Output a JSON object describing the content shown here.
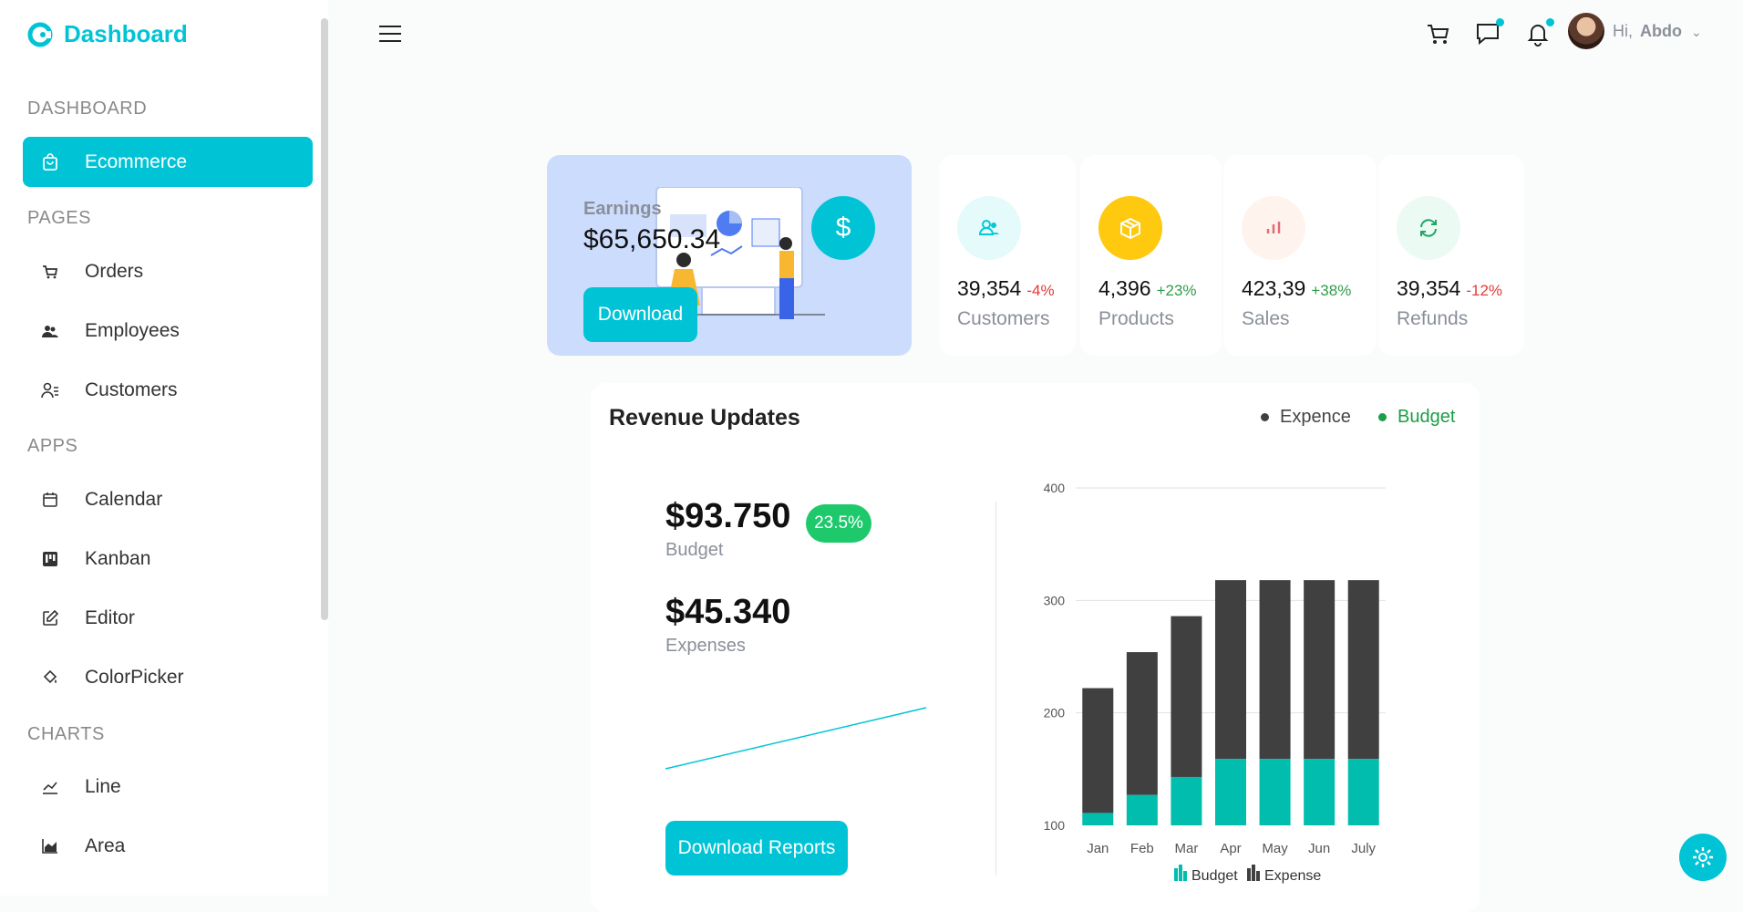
{
  "brand": {
    "name": "Dashboard"
  },
  "sidebar": {
    "sections": {
      "dashboard": "DASHBOARD",
      "pages": "PAGES",
      "apps": "APPS",
      "charts": "CHARTS"
    },
    "items": [
      {
        "label": "Ecommerce",
        "icon": "shopping-bag-icon"
      },
      {
        "label": "Orders",
        "icon": "cart-icon"
      },
      {
        "label": "Employees",
        "icon": "employees-icon"
      },
      {
        "label": "Customers",
        "icon": "customers-icon"
      },
      {
        "label": "Calendar",
        "icon": "calendar-icon"
      },
      {
        "label": "Kanban",
        "icon": "kanban-icon"
      },
      {
        "label": "Editor",
        "icon": "editor-icon"
      },
      {
        "label": "ColorPicker",
        "icon": "paint-bucket-icon"
      },
      {
        "label": "Line",
        "icon": "line-chart-icon"
      },
      {
        "label": "Area",
        "icon": "area-chart-icon"
      }
    ]
  },
  "header": {
    "greeting": "Hi,",
    "user": "Abdo"
  },
  "earnings": {
    "label": "Earnings",
    "value": "$65,650.34",
    "button": "Download",
    "currency_symbol": "$"
  },
  "stats": [
    {
      "value": "39,354",
      "percent": "-4%",
      "label": "Customers",
      "pct_color": "#e53935",
      "icon": "users-icon",
      "icon_bg": "#e5fafb",
      "icon_color": "#03c9d7"
    },
    {
      "value": "4,396",
      "percent": "+23%",
      "label": "Products",
      "pct_color": "#2e9d4a",
      "icon": "box-icon",
      "icon_bg": "#fec90f",
      "icon_color": "#ffffff"
    },
    {
      "value": "423,39",
      "percent": "+38%",
      "label": "Sales",
      "pct_color": "#2e9d4a",
      "icon": "bar-chart-icon",
      "icon_bg": "#fff4ed",
      "icon_color": "#e46a76"
    },
    {
      "value": "39,354",
      "percent": "-12%",
      "label": "Refunds",
      "pct_color": "#e53935",
      "icon": "refresh-icon",
      "icon_bg": "#ebfaf2",
      "icon_color": "#1fa766"
    }
  ],
  "revenue": {
    "title": "Revenue Updates",
    "legend_expence": "Expence",
    "legend_budget": "Budget",
    "budget_value": "$93.750",
    "budget_label": "Budget",
    "budget_pct": "23.5%",
    "expenses_value": "$45.340",
    "expenses_label": "Expenses",
    "download": "Download Reports"
  },
  "colors": {
    "accent": "#00c4d6",
    "expense": "#404041",
    "budget": "#00bdae",
    "green": "#1a9e47"
  },
  "chart_data": {
    "type": "bar",
    "stacked": true,
    "categories": [
      "Jan",
      "Feb",
      "Mar",
      "Apr",
      "May",
      "Jun",
      "July"
    ],
    "series": [
      {
        "name": "Budget",
        "values": [
          111,
          127,
          143,
          159,
          159,
          159,
          159
        ]
      },
      {
        "name": "Expense",
        "values": [
          111,
          127,
          143,
          159,
          159,
          159,
          159
        ]
      }
    ],
    "ylim": [
      100,
      400
    ],
    "yticks": [
      100,
      200,
      300,
      400
    ],
    "grid": true,
    "legend_position": "bottom"
  }
}
